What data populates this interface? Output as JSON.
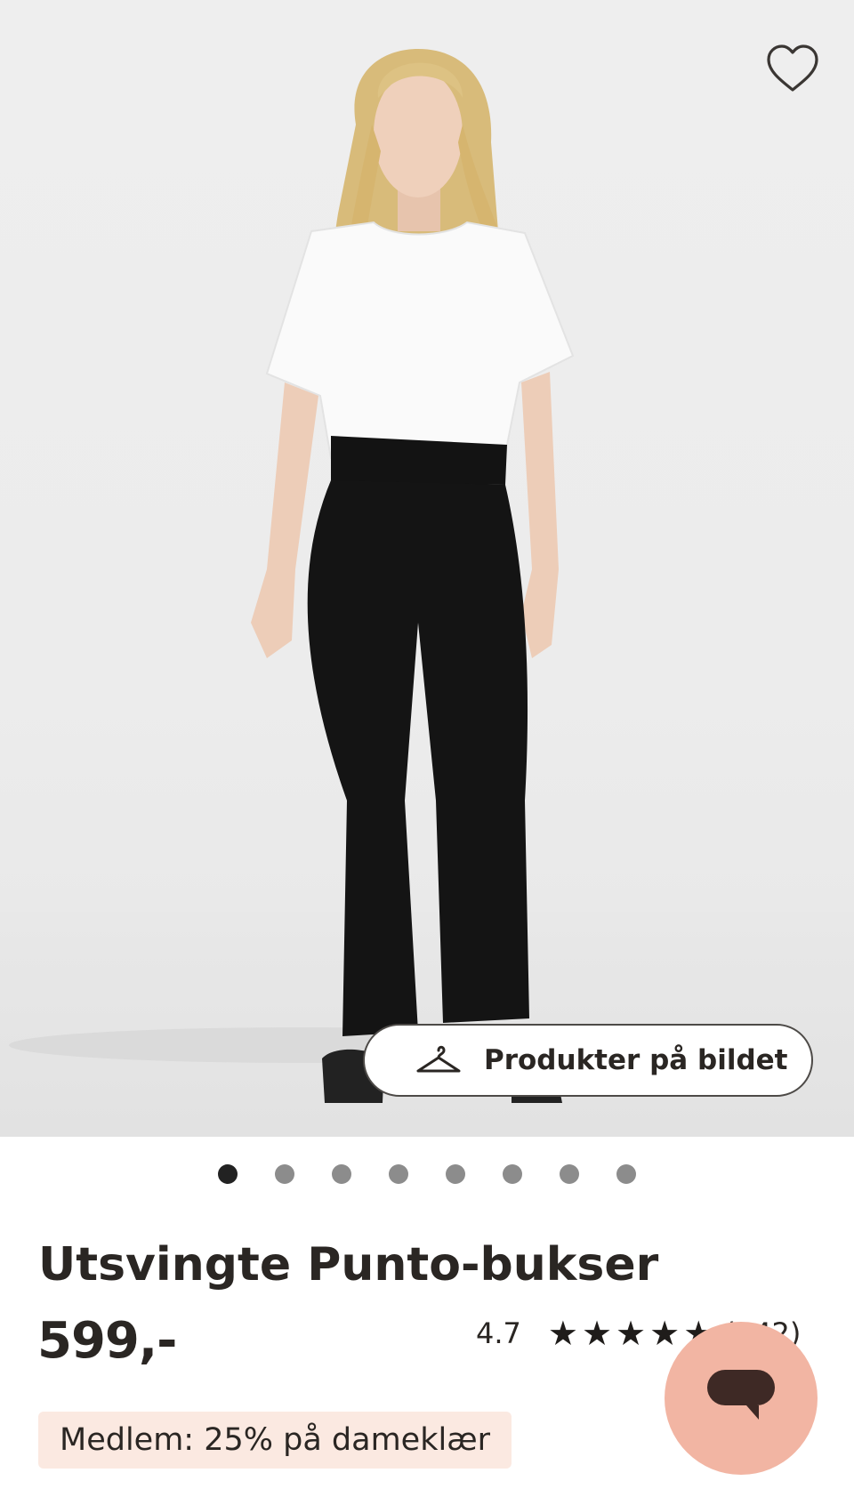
{
  "product": {
    "image_alt": "Modell i hvit t-skjorte og svarte utsvingte bukser",
    "favorite_icon": "heart-outline-icon",
    "products_in_image_label": "Produkter på bildet",
    "products_in_image_icon": "hanger-icon",
    "carousel": {
      "total": 8,
      "active_index": 0
    },
    "title": "Utsvingte Punto-bukser",
    "price": "599,-",
    "rating": {
      "score": "4.7",
      "stars": 5,
      "count": "(142)"
    },
    "promo": "Medlem: 25% på dameklær"
  },
  "chat": {
    "icon": "chat-bubble-icon"
  },
  "colors": {
    "text": "#2a2623",
    "promo_bg": "#fbe9e1",
    "chat_bg": "#f2b5a3",
    "chat_icon": "#3e2925",
    "dot_active": "#222222",
    "dot_inactive": "#8c8c8c"
  }
}
